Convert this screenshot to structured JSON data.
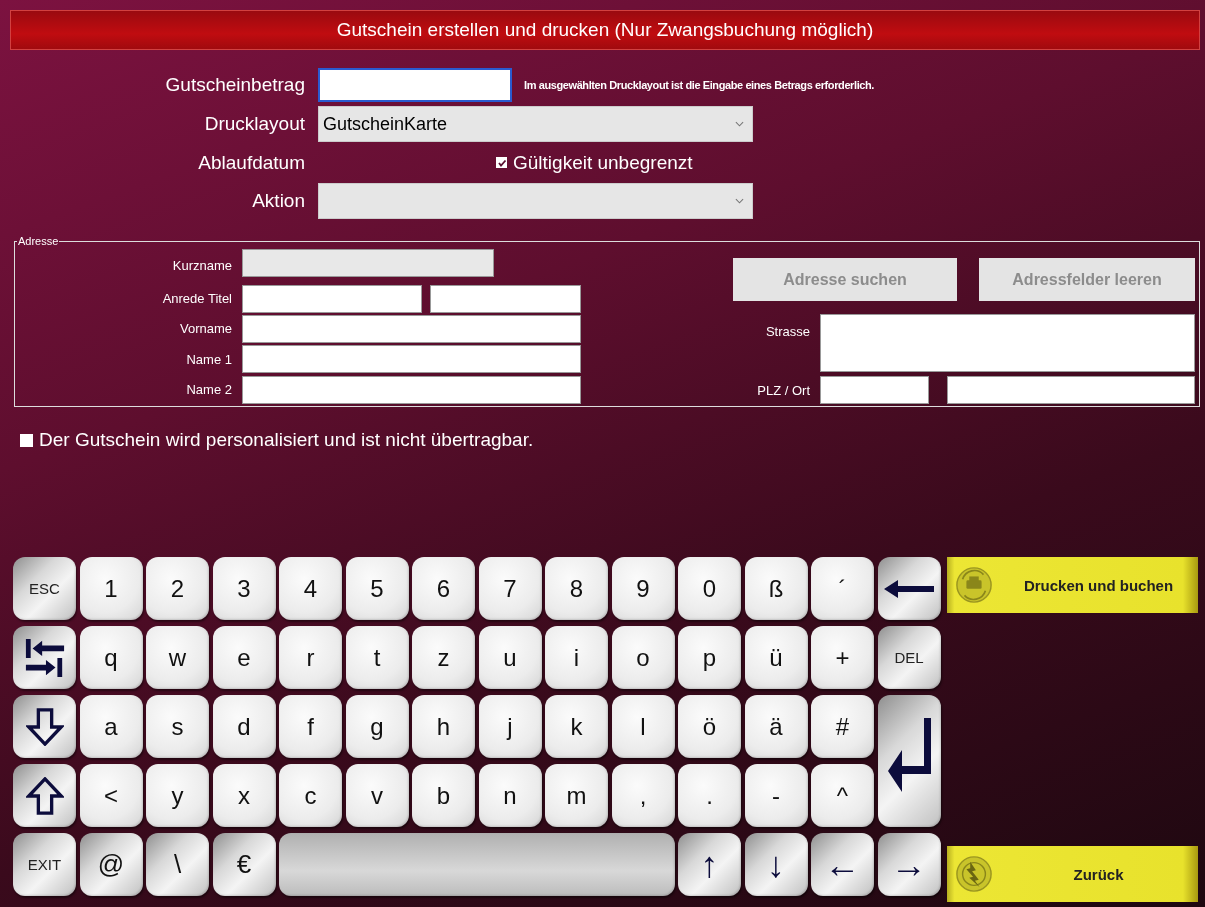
{
  "window": {
    "title": "Gutschein erstellen und drucken (Nur Zwangsbuchung möglich)"
  },
  "form": {
    "amount": {
      "label": "Gutscheinbetrag",
      "focused": true,
      "hint": "Im ausgewählten Drucklayout ist die Eingabe eines Betrags erforderlich."
    },
    "layout": {
      "label": "Drucklayout",
      "value": "GutscheinKarte"
    },
    "expiry": {
      "label": "Ablaufdatum",
      "unlimited": {
        "label": "Gültigkeit unbegrenzt",
        "checked": true
      }
    },
    "action": {
      "label": "Aktion"
    }
  },
  "address": {
    "legend": "Adresse",
    "short_name": {
      "label": "Kurzname",
      "disabled": true
    },
    "salutation": {
      "label": "Anrede Titel"
    },
    "first_name": {
      "label": "Vorname"
    },
    "name1": {
      "label": "Name 1"
    },
    "name2": {
      "label": "Name 2"
    },
    "buttons": [
      {
        "label": "Adresse suchen",
        "disabled": true
      },
      {
        "label": "Adressfelder leeren",
        "disabled": true
      }
    ],
    "street": {
      "label": "Strasse"
    },
    "city": {
      "label": "PLZ / Ort"
    }
  },
  "personalized": {
    "label": "Der Gutschein wird personalisiert und ist nicht übertragbar.",
    "checked": false
  },
  "keyboard": {
    "keys": [
      {
        "kind": "fn",
        "label": "ESC"
      },
      {
        "kind": "key",
        "label": "1"
      },
      {
        "kind": "key",
        "label": "2"
      },
      {
        "kind": "key",
        "label": "3"
      },
      {
        "kind": "key",
        "label": "4"
      },
      {
        "kind": "key",
        "label": "5"
      },
      {
        "kind": "key",
        "label": "6"
      },
      {
        "kind": "key",
        "label": "7"
      },
      {
        "kind": "key",
        "label": "8"
      },
      {
        "kind": "key",
        "label": "9"
      },
      {
        "kind": "key",
        "label": "0"
      },
      {
        "kind": "key",
        "label": "ß"
      },
      {
        "kind": "key",
        "label": "´"
      },
      {
        "kind": "backspace"
      },
      {
        "kind": "tab"
      },
      {
        "kind": "key",
        "label": "q"
      },
      {
        "kind": "key",
        "label": "w"
      },
      {
        "kind": "key",
        "label": "e"
      },
      {
        "kind": "key",
        "label": "r"
      },
      {
        "kind": "key",
        "label": "t"
      },
      {
        "kind": "key",
        "label": "z"
      },
      {
        "kind": "key",
        "label": "u"
      },
      {
        "kind": "key",
        "label": "i"
      },
      {
        "kind": "key",
        "label": "o"
      },
      {
        "kind": "key",
        "label": "p"
      },
      {
        "kind": "key",
        "label": "ü"
      },
      {
        "kind": "key",
        "label": "+"
      },
      {
        "kind": "fn",
        "label": "DEL"
      },
      {
        "kind": "down"
      },
      {
        "kind": "key",
        "label": "a"
      },
      {
        "kind": "key",
        "label": "s"
      },
      {
        "kind": "key",
        "label": "d"
      },
      {
        "kind": "key",
        "label": "f"
      },
      {
        "kind": "key",
        "label": "g"
      },
      {
        "kind": "key",
        "label": "h"
      },
      {
        "kind": "key",
        "label": "j"
      },
      {
        "kind": "key",
        "label": "k"
      },
      {
        "kind": "key",
        "label": "l"
      },
      {
        "kind": "key",
        "label": "ö"
      },
      {
        "kind": "key",
        "label": "ä"
      },
      {
        "kind": "key",
        "label": "#"
      },
      {
        "kind": "enter"
      },
      {
        "kind": "shift"
      },
      {
        "kind": "key",
        "label": "<"
      },
      {
        "kind": "key",
        "label": "y"
      },
      {
        "kind": "key",
        "label": "x"
      },
      {
        "kind": "key",
        "label": "c"
      },
      {
        "kind": "key",
        "label": "v"
      },
      {
        "kind": "key",
        "label": "b"
      },
      {
        "kind": "key",
        "label": "n"
      },
      {
        "kind": "key",
        "label": "m"
      },
      {
        "kind": "key",
        "label": ","
      },
      {
        "kind": "key",
        "label": "."
      },
      {
        "kind": "key",
        "label": "-"
      },
      {
        "kind": "key",
        "label": "^"
      },
      {
        "kind": "fn",
        "label": "EXIT"
      },
      {
        "kind": "alt",
        "label": "@"
      },
      {
        "kind": "alt",
        "label": "\\"
      },
      {
        "kind": "alt",
        "label": "€"
      },
      {
        "kind": "space"
      },
      {
        "kind": "arrow",
        "label": "↑"
      },
      {
        "kind": "arrow",
        "label": "↓"
      },
      {
        "kind": "arrow",
        "label": "←"
      },
      {
        "kind": "arrow",
        "label": "→"
      }
    ]
  },
  "actions": [
    {
      "kind": "print",
      "label": "Drucken und buchen"
    },
    {
      "kind": "back",
      "label": "Zurück"
    }
  ]
}
